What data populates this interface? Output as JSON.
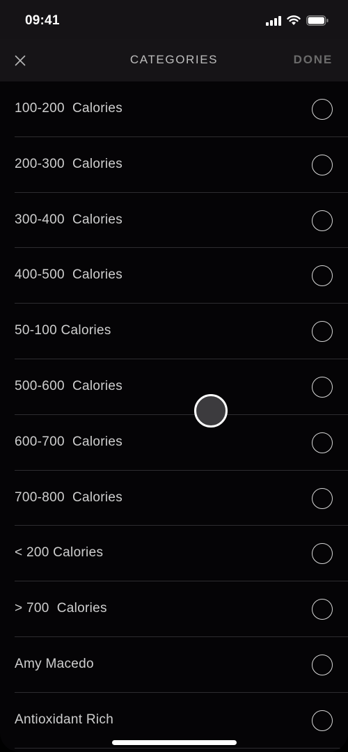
{
  "status_bar": {
    "time": "09:41",
    "icons": [
      "signal-icon",
      "wifi-icon",
      "battery-icon"
    ]
  },
  "nav": {
    "close_icon": "close-icon",
    "title": "CATEGORIES",
    "done_label": "DONE"
  },
  "categories": [
    {
      "label": "100-200  Calories",
      "selected": false
    },
    {
      "label": "200-300  Calories",
      "selected": false
    },
    {
      "label": "300-400  Calories",
      "selected": false
    },
    {
      "label": "400-500  Calories",
      "selected": false
    },
    {
      "label": "50-100 Calories",
      "selected": false
    },
    {
      "label": "500-600  Calories",
      "selected": false
    },
    {
      "label": "600-700  Calories",
      "selected": false
    },
    {
      "label": "700-800  Calories",
      "selected": false
    },
    {
      "label": "< 200 Calories",
      "selected": false
    },
    {
      "label": "> 700  Calories",
      "selected": false
    },
    {
      "label": "Amy Macedo",
      "selected": false
    },
    {
      "label": "Antioxidant Rich",
      "selected": false
    }
  ],
  "colors": {
    "background": "#050406",
    "nav_background": "#161417",
    "text": "#cfcfcf",
    "done_disabled": "#6b6b6b",
    "separator": "#2e2d30"
  }
}
